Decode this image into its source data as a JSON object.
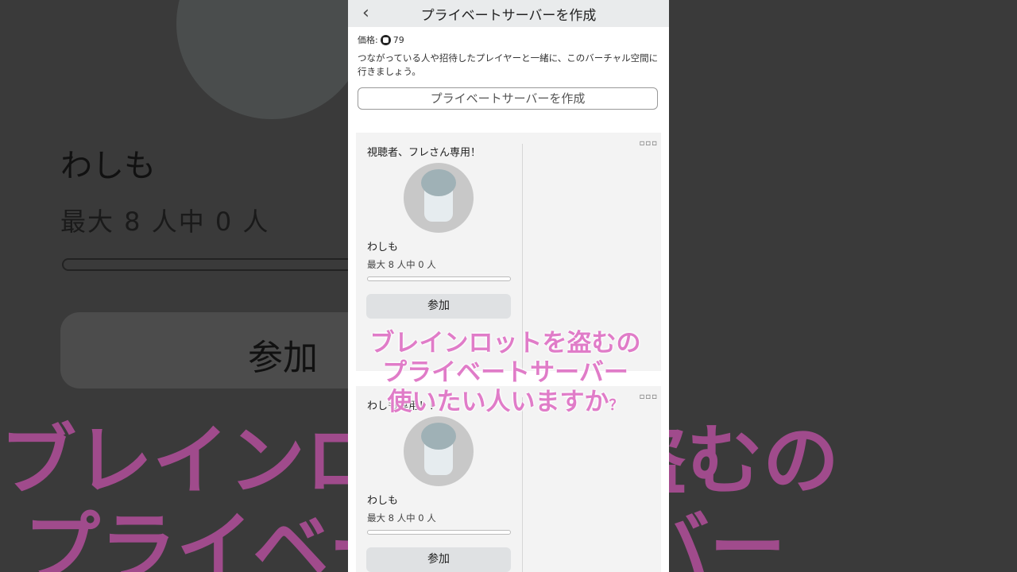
{
  "background": {
    "name": "わしも",
    "count": "最大 8 人中 0 人",
    "join_label": "参加",
    "overlay_lines": [
      "ブレインロットを盗むの",
      "プライベートサーバー"
    ]
  },
  "header": {
    "back_icon": "chevron-left-icon",
    "title": "プライベートサーバーを作成"
  },
  "price": {
    "label": "価格:",
    "value": "79",
    "icon": "robux-icon"
  },
  "description": "つながっている人や招待したプレイヤーと一緒に、このバーチャル空間に行きましょう。",
  "create_button": "プライベートサーバーを作成",
  "servers": [
    {
      "name": "視聴者、フレさん専用！",
      "owner": "わしも",
      "count": "最大 8 人中 0 人",
      "progress": 0,
      "join_label": "参加",
      "menu_icon": "more-dots-icon"
    },
    {
      "name": "わしも専用！！",
      "owner": "わしも",
      "count": "最大 8 人中 0 人",
      "progress": 0,
      "join_label": "参加",
      "menu_icon": "more-dots-icon"
    }
  ],
  "overlay_caption": {
    "line1": "ブレインロットを盗むの",
    "line2": "プライベートサーバー",
    "line3": "使いたい人いますか",
    "line3_mark": "？"
  },
  "colors": {
    "overlay_text": "#e07cc8",
    "join_button": "#dfe1e3",
    "topbar": "#e9ebec"
  }
}
